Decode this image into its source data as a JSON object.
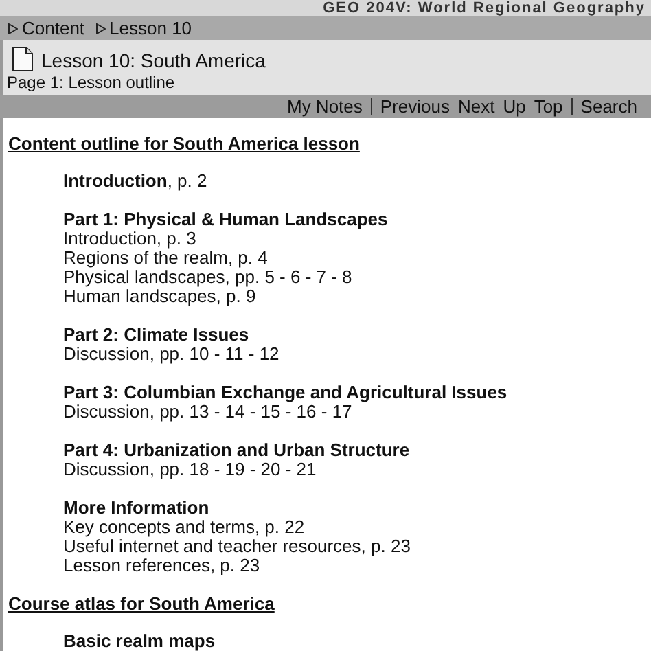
{
  "course_title": "GEO 204V: World Regional Geography",
  "breadcrumbs": [
    {
      "label": "Content"
    },
    {
      "label": "Lesson 10"
    }
  ],
  "lesson_title": "Lesson 10: South America",
  "page_title": "Page 1: Lesson outline",
  "nav_groups": [
    [
      "My Notes"
    ],
    [
      "Previous",
      "Next",
      "Up",
      "Top"
    ],
    [
      "Search"
    ]
  ],
  "sections": [
    {
      "heading": "Content outline for South America lesson",
      "groups": [
        {
          "title": "Introduction",
          "suffix": ", p. 2"
        },
        {
          "title": "Part 1: Physical & Human Landscapes",
          "lines": [
            "Introduction, p. 3",
            "Regions of the realm, p. 4",
            "Physical landscapes, pp. 5 - 6 - 7 - 8",
            "Human landscapes, p. 9"
          ]
        },
        {
          "title": "Part 2: Climate Issues",
          "lines": [
            "Discussion, pp. 10 - 11 - 12"
          ]
        },
        {
          "title": "Part 3: Columbian Exchange and Agricultural Issues",
          "lines": [
            "Discussion, pp. 13 - 14 - 15 - 16 - 17"
          ]
        },
        {
          "title": "Part 4: Urbanization and Urban Structure",
          "lines": [
            "Discussion, pp. 18 - 19 - 20 - 21"
          ]
        },
        {
          "title": "More Information",
          "lines": [
            "Key concepts and terms, p. 22",
            "Useful internet and teacher resources, p. 23",
            "Lesson references, p. 23"
          ]
        }
      ]
    },
    {
      "heading": "Course atlas for South America",
      "groups": [
        {
          "title": "Basic realm maps"
        }
      ]
    }
  ]
}
